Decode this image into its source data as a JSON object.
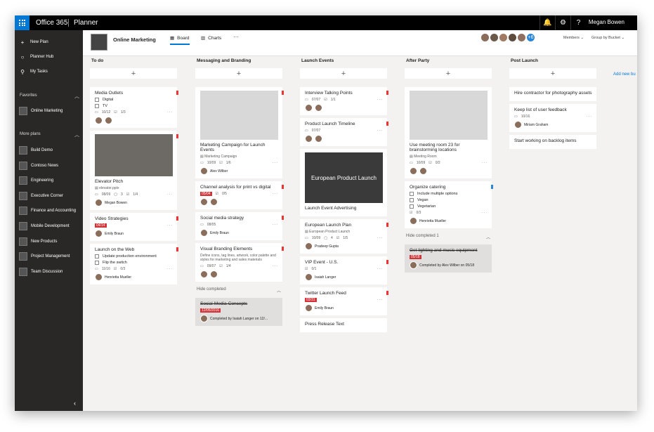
{
  "topbar": {
    "brand": "Office 365",
    "app": "Planner",
    "user": "Megan Bowen",
    "icons": [
      "bell-icon",
      "gear-icon",
      "help-icon"
    ]
  },
  "sidebar": {
    "nav": [
      {
        "icon": "plus",
        "label": "New Plan"
      },
      {
        "icon": "circle",
        "label": "Planner Hub"
      },
      {
        "icon": "person",
        "label": "My Tasks"
      }
    ],
    "favorites_label": "Favorites",
    "favorites": [
      "Online Marketing"
    ],
    "more_label": "More plans",
    "plans": [
      "Build Demo",
      "Contoso News",
      "Engineering",
      "Executive Corner",
      "Finance and Accounting",
      "Mobile Development",
      "New Products",
      "Project Management",
      "Team Discussion"
    ]
  },
  "header": {
    "plan": "Online Marketing",
    "tab_board": "Board",
    "tab_charts": "Charts",
    "more": "···",
    "members": "Members",
    "group": "Group by Bucket",
    "add_member": "+6",
    "add_bucket": "Add new bu"
  },
  "buckets": [
    {
      "title": "To do",
      "cards": [
        {
          "title": "Media Outlets",
          "checks": [
            "Digital",
            "TV"
          ],
          "date": "10/12",
          "prog": "1/3"
        },
        {
          "title": "Elevator Pitch",
          "attach": "elevator.pptx",
          "date": "08/09",
          "count": "3",
          "prog": "1/4",
          "assignee": "Megan Bowen"
        },
        {
          "title": "Video Strategies",
          "due": "04/14",
          "assignee": "Emily Braun"
        },
        {
          "title": "Launch on the Web",
          "checks": [
            "Update production environment",
            "Flip the switch"
          ],
          "date": "11/16",
          "prog": "0/3",
          "assignee": "Henrietta Mueller"
        }
      ]
    },
    {
      "title": "Messaging and Branding",
      "cards": [
        {
          "title": "Marketing Campaign for Launch Events",
          "attach": "Marketing Campaign",
          "date": "10/09",
          "prog": "1/6",
          "assignee": "Alex Wilber"
        },
        {
          "title": "Channel analysis for print vs digital",
          "due": "05/04",
          "prog": "0/5"
        },
        {
          "title": "Social media strategy",
          "date": "08/05",
          "assignee": "Emily Braun"
        },
        {
          "title": "Visual Branding Elements",
          "desc": "Define icons, tag lines, artwork, color palette and styles for marketing and sales materials",
          "date": "09/07",
          "prog": "1/4"
        }
      ],
      "hide": "Hide completed",
      "done": {
        "title": "Social-Media-Concepts",
        "due": "12/05/2016",
        "by": "Completed by Isaiah Langer on 12/..."
      }
    },
    {
      "title": "Launch Events",
      "cards": [
        {
          "title": "Interview Talking Points",
          "date": "07/07",
          "prog": "1/1"
        },
        {
          "title": "Product Launch Timeline",
          "date": "07/07"
        },
        {
          "title": "Launch Event Advertising",
          "img_text": "European Product Launch"
        },
        {
          "title": "European Launch Plan",
          "attach": "European Product Launch",
          "date": "10/09",
          "count": "4",
          "prog": "1/5",
          "assignee": "Pradeep Gupta"
        },
        {
          "title": "VIP Event - U.S.",
          "prog": "0/1",
          "assignee": "Isaiah Langer"
        },
        {
          "title": "Twitter Launch Feed",
          "due": "03/31",
          "assignee": "Emily Braun"
        },
        {
          "title": "Press Release Text"
        }
      ]
    },
    {
      "title": "After Party",
      "cards": [
        {
          "title": "Use meeting room 23 for brainstorming locations",
          "attach": "Meeting Room",
          "date": "10/09",
          "prog": "0/2"
        },
        {
          "title": "Organize catering",
          "checks": [
            "Include multiple options",
            "Vegan",
            "Vegetarian"
          ],
          "prog": "0/3",
          "assignee": "Henrietta Mueller"
        }
      ],
      "hide": "Hide completed",
      "hide_count": "1",
      "done": {
        "title": "Get lighting and music equipment",
        "due": "05/18",
        "by": "Completed by Alex Wilber on 05/18"
      }
    },
    {
      "title": "Post Launch",
      "cards": [
        {
          "title": "Hire contractor for photography assets"
        },
        {
          "title": "Keep list of user feedback",
          "date": "10/16",
          "assignee": "Miriam Graham"
        },
        {
          "title": "Start working on backlog items"
        }
      ]
    }
  ]
}
